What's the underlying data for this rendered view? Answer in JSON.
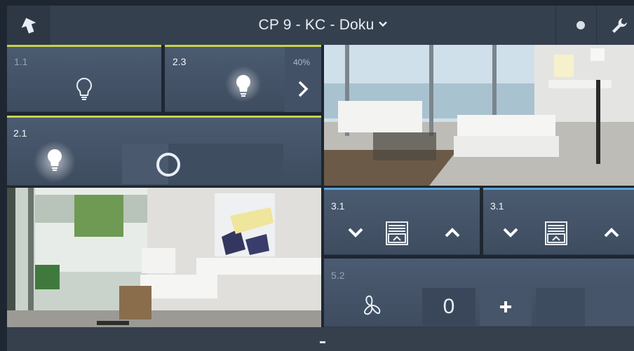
{
  "header": {
    "title": "CP 9 - KC - Doku",
    "back_icon": "back-arrow-icon",
    "dropdown_icon": "chevron-down-icon",
    "status_icon": "dot-icon",
    "settings_icon": "wrench-icon"
  },
  "tiles": {
    "light_1_1": {
      "label": "1.1",
      "state": "off",
      "accent": "#c9d24a"
    },
    "light_2_3": {
      "label": "2.3",
      "state": "on",
      "level": "40%",
      "accent": "#c9d24a"
    },
    "light_2_1": {
      "label": "2.1",
      "state": "on",
      "accent": "#c9d24a"
    },
    "blind_3_1_a": {
      "label": "3.1",
      "accent": "#5aa6d6"
    },
    "blind_3_1_b": {
      "label": "3.1",
      "accent": "#5aa6d6"
    },
    "fan_5_2": {
      "label": "5.2",
      "value": "0"
    }
  },
  "colors": {
    "tile_bg": "#445368",
    "header_bg": "#35404e",
    "light_accent": "#c9d24a",
    "blind_accent": "#5aa6d6"
  }
}
